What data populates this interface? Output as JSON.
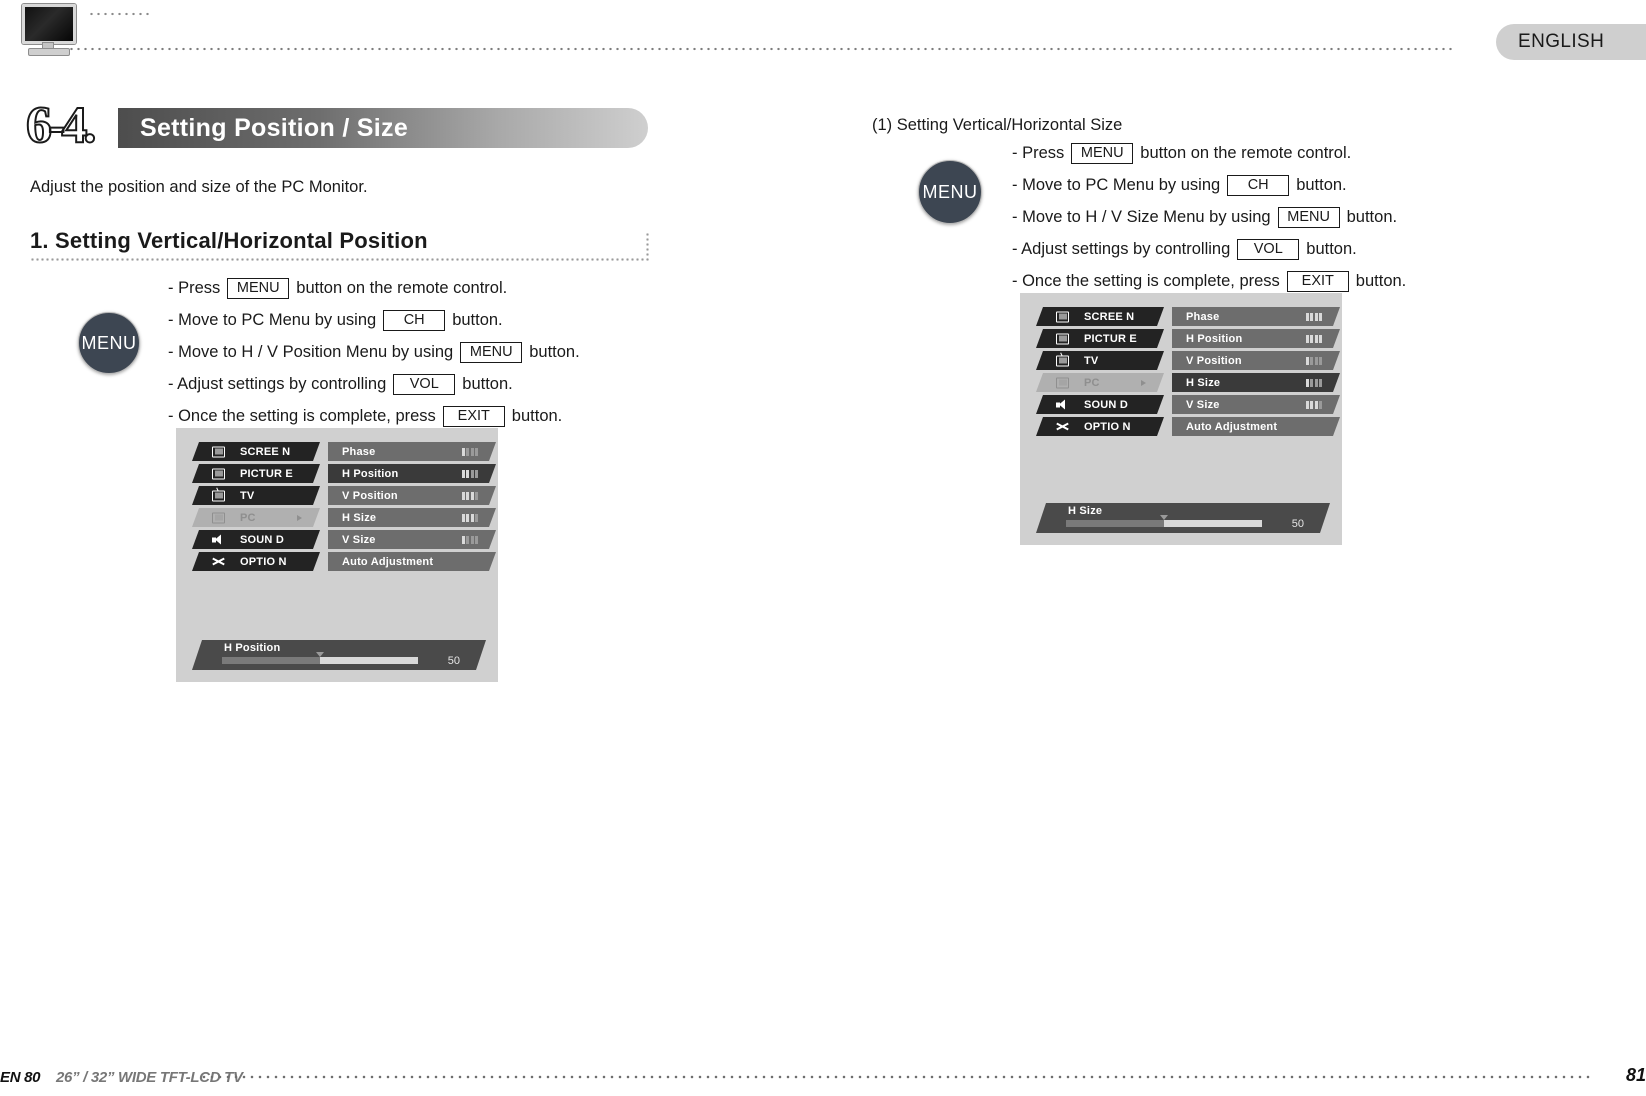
{
  "header": {
    "language": "ENGLISH",
    "tv_icon": "tv-monitor-icon"
  },
  "section": {
    "number": "6-4.",
    "title": "Setting Position / Size",
    "intro": "Adjust the position and size of the PC Monitor."
  },
  "left_block": {
    "subheading": "1. Setting Vertical/Horizontal Position",
    "badge": "MENU",
    "steps": [
      {
        "pre": "- Press",
        "key": "MENU",
        "post": "button on the remote control."
      },
      {
        "pre": "- Move to PC Menu by using",
        "key": "CH",
        "post": "button."
      },
      {
        "pre": "- Move to H / V Position Menu by using",
        "key": "MENU",
        "post": "button."
      },
      {
        "pre": "- Adjust settings by controlling",
        "key": "VOL",
        "post": "button."
      },
      {
        "pre": "- Once the setting is complete, press",
        "key": "EXIT",
        "post": "button."
      }
    ],
    "osd": {
      "categories": [
        {
          "label": "SCREE N",
          "icon": "screen-icon",
          "selected": false
        },
        {
          "label": "PICTUR E",
          "icon": "picture-icon",
          "selected": false
        },
        {
          "label": "TV",
          "icon": "tv-icon",
          "selected": false
        },
        {
          "label": "PC",
          "icon": "pc-icon",
          "selected": true
        },
        {
          "label": "SOUN D",
          "icon": "sound-icon",
          "selected": false
        },
        {
          "label": "OPTIO N",
          "icon": "option-icon",
          "selected": false
        }
      ],
      "options": [
        {
          "label": "Phase",
          "level": 1,
          "highlighted": false
        },
        {
          "label": "H Position",
          "level": 2,
          "highlighted": true
        },
        {
          "label": "V Position",
          "level": 3,
          "highlighted": false
        },
        {
          "label": "H Size",
          "level": 3,
          "highlighted": false
        },
        {
          "label": "V Size",
          "level": 1,
          "highlighted": false
        },
        {
          "label": "Auto Adjustment",
          "level": 0,
          "highlighted": false
        }
      ],
      "slider": {
        "label": "H Position",
        "value": "50",
        "percent": 50
      }
    }
  },
  "right_block": {
    "subheading": "(1) Setting Vertical/Horizontal Size",
    "badge": "MENU",
    "steps": [
      {
        "pre": "- Press",
        "key": "MENU",
        "post": "button on the remote control."
      },
      {
        "pre": "- Move to PC Menu by using",
        "key": "CH",
        "post": "button."
      },
      {
        "pre": "- Move to H / V Size Menu by using",
        "key": "MENU",
        "post": "button."
      },
      {
        "pre": "- Adjust settings by controlling",
        "key": "VOL",
        "post": "button."
      },
      {
        "pre": "- Once the setting is complete, press",
        "key": "EXIT",
        "post": "button."
      }
    ],
    "osd": {
      "categories": [
        {
          "label": "SCREE N",
          "icon": "screen-icon",
          "selected": false
        },
        {
          "label": "PICTUR E",
          "icon": "picture-icon",
          "selected": false
        },
        {
          "label": "TV",
          "icon": "tv-icon",
          "selected": false
        },
        {
          "label": "PC",
          "icon": "pc-icon",
          "selected": true
        },
        {
          "label": "SOUN D",
          "icon": "sound-icon",
          "selected": false
        },
        {
          "label": "OPTIO N",
          "icon": "option-icon",
          "selected": false
        }
      ],
      "options": [
        {
          "label": "Phase",
          "level": 4,
          "highlighted": false
        },
        {
          "label": "H Position",
          "level": 4,
          "highlighted": false
        },
        {
          "label": "V Position",
          "level": 1,
          "highlighted": false
        },
        {
          "label": "H Size",
          "level": 1,
          "highlighted": true
        },
        {
          "label": "V Size",
          "level": 3,
          "highlighted": false
        },
        {
          "label": "Auto Adjustment",
          "level": 0,
          "highlighted": false
        }
      ],
      "slider": {
        "label": "H Size",
        "value": "50",
        "percent": 50
      }
    }
  },
  "footer": {
    "left": "EN 80",
    "model": "26” / 32” WIDE TFT-LCD TV",
    "page": "81"
  },
  "colors": {
    "bar_gradient_start": "#4d4d4d",
    "bar_gradient_end": "#cfcfcf",
    "osd_background": "#d0d0d0",
    "osd_category": "#232323",
    "osd_option": "#6d6d6d",
    "osd_highlight": "#3a3a3a",
    "badge": "#3d4652"
  }
}
